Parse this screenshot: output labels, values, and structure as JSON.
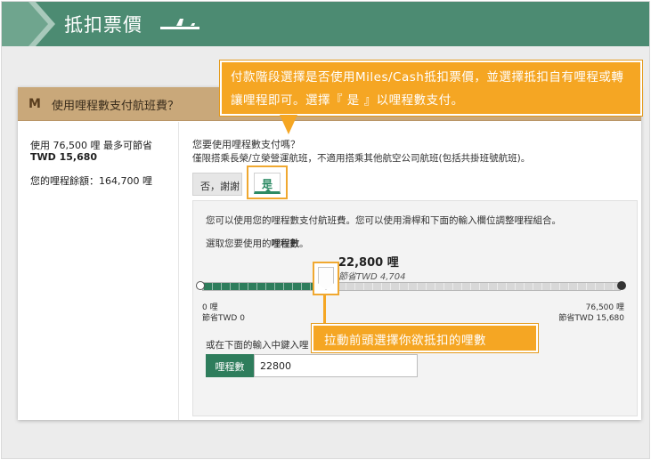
{
  "banner": {
    "title": "抵扣票價",
    "color": "#4c8b72"
  },
  "card": {
    "header_icon": "M",
    "header_title": "使用哩程數支付航班費？",
    "left": {
      "line1": "使用 76,500 哩 最多可節省",
      "line2": "TWD 15,680",
      "line3": "您的哩程餘額：164,700 哩"
    },
    "question": {
      "line1": "您要使用哩程數支付嗎？",
      "line2": "僅限搭乘長榮/立榮營運航班，不適用搭乘其他航空公司航班(包括共掛班號航班)。"
    },
    "tabs": {
      "no_label": "否，謝謝",
      "yes_label": "是"
    },
    "panel": {
      "text1": "您可以使用您的哩程數支付航班費。您可以使用滑桿和下面的輸入欄位調整哩程組合。",
      "text2": "選取您要使用的哩程數。",
      "selected_miles": "22,800 哩",
      "selected_save": "節省TWD 4,704",
      "slider_fraction": 0.298,
      "min_miles": "0 哩",
      "min_save": "節省TWD 0",
      "max_miles": "76,500 哩",
      "max_save": "節省TWD 15,680",
      "input_label": "或在下面的輸入中鍵入哩",
      "input_tag": "哩程數",
      "input_value": "22800"
    }
  },
  "callouts": {
    "top": "付款階段選擇是否使用Miles/Cash抵扣票價，並選擇抵扣自有哩程或轉讓哩程即可。選擇『 是 』以哩程數支付。",
    "bottom": "拉動前頭選擇你欲抵扣的哩數"
  },
  "colors": {
    "accent_green": "#2e7d5c",
    "callout_orange": "#f5a623",
    "header_tan": "#c9a87a"
  }
}
